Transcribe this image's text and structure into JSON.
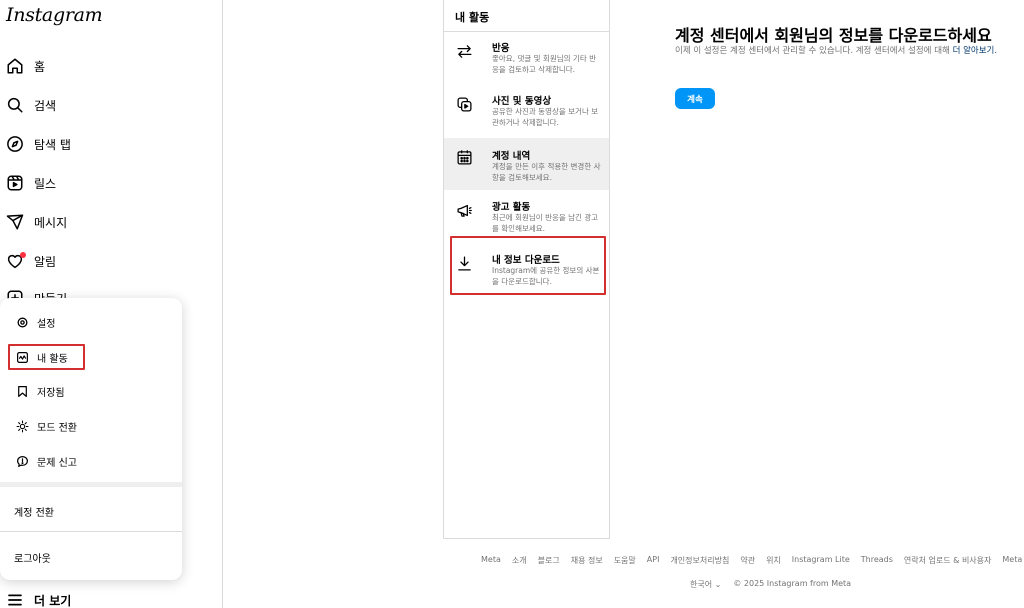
{
  "app": {
    "logo": "Instagram"
  },
  "nav": {
    "items": [
      {
        "label": "홈",
        "icon": "home-icon"
      },
      {
        "label": "검색",
        "icon": "search-icon"
      },
      {
        "label": "탐색 탭",
        "icon": "explore-icon"
      },
      {
        "label": "릴스",
        "icon": "reels-icon"
      },
      {
        "label": "메시지",
        "icon": "messages-icon"
      },
      {
        "label": "알림",
        "icon": "heart-icon"
      },
      {
        "label": "만들기",
        "icon": "create-icon"
      }
    ],
    "more_label": "더 보기"
  },
  "more_menu": {
    "items": [
      {
        "label": "설정",
        "icon": "settings-icon"
      },
      {
        "label": "내 활동",
        "icon": "activity-icon"
      },
      {
        "label": "저장됨",
        "icon": "bookmark-icon"
      },
      {
        "label": "모드 전환",
        "icon": "sun-icon"
      },
      {
        "label": "문제 신고",
        "icon": "report-icon"
      }
    ],
    "switch_account": "계정 전환",
    "logout": "로그아웃"
  },
  "activity_panel": {
    "title": "내 활동",
    "items": [
      {
        "title": "반응",
        "desc": "좋아요, 댓글 및 회원님의 기타 반응을 검토하고 삭제합니다.",
        "icon": "interactions-icon"
      },
      {
        "title": "사진 및 동영상",
        "desc": "공유한 사진과 동영상을 보거나 보관하거나 삭제합니다.",
        "icon": "photos-videos-icon"
      },
      {
        "title": "계정 내역",
        "desc": "계정을 만든 이후 적용한 변경한 사항을 검토해보세요.",
        "icon": "calendar-icon"
      },
      {
        "title": "광고 활동",
        "desc": "최근에 회원님이 반응을 남긴 광고를 확인해보세요.",
        "icon": "megaphone-icon"
      },
      {
        "title": "내 정보 다운로드",
        "desc": "Instagram에 공유한 정보의 사본을 다운로드합니다.",
        "icon": "download-icon"
      }
    ]
  },
  "content": {
    "title": "계정 센터에서 회원님의 정보를 다운로드하세요",
    "desc": "이제 이 설정은 계정 센터에서 관리할 수 있습니다. 계정 센터에서 설정에 대해 ",
    "link": "더 알아보기.",
    "continue_label": "계속"
  },
  "footer": {
    "links": [
      "Meta",
      "소개",
      "블로그",
      "채용 정보",
      "도움말",
      "API",
      "개인정보처리방침",
      "약관",
      "위치",
      "Instagram Lite",
      "Threads",
      "연락처 업로드 & 비사용자",
      "Meta Verified"
    ],
    "language": "한국어",
    "copyright": "© 2025 Instagram from Meta"
  },
  "colors": {
    "accent": "#0095f6",
    "highlight_border": "#d32f2f",
    "notification": "#ff3040",
    "muted_text": "#737373"
  }
}
